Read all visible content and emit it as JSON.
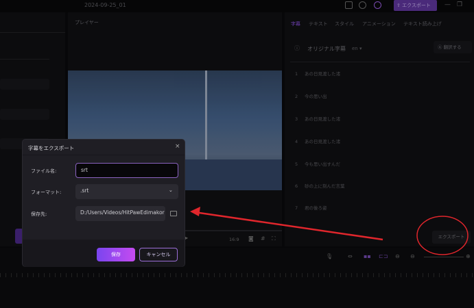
{
  "topbar": {
    "project_name": "2024-09-25_01",
    "export_label": "エクスポート"
  },
  "player": {
    "title": "プレイヤー",
    "aspect": "16:9"
  },
  "right_panel": {
    "tabs": [
      "字幕",
      "テキスト",
      "スタイル",
      "アニメーション",
      "テキスト読み上げ"
    ],
    "original_label": "オリジナル字幕",
    "language": "en",
    "translate_label": "翻訳する",
    "subtitles": [
      {
        "n": "1",
        "text": "あの日見渡した渚"
      },
      {
        "n": "2",
        "text": "今の思い出"
      },
      {
        "n": "3",
        "text": "あの日見渡した渚"
      },
      {
        "n": "4",
        "text": "あの日見渡した渚"
      },
      {
        "n": "5",
        "text": "今も思い出すんだ"
      },
      {
        "n": "6",
        "text": "砂の上に刻んだ言葉"
      },
      {
        "n": "7",
        "text": "君の後ろ姿"
      }
    ],
    "export_label": "エクスポート"
  },
  "dialog": {
    "title": "字幕をエクスポート",
    "filename_label": "ファイル名:",
    "filename_value": "srt",
    "format_label": "フォーマット:",
    "format_value": ".srt",
    "save_to_label": "保存先:",
    "save_to_value": "D:/Users/Videos/HitPawEdimakor",
    "save_label": "保存",
    "cancel_label": "キャンセル"
  },
  "colors": {
    "accent": "#8b4cf0",
    "annotation": "#e0262c"
  }
}
